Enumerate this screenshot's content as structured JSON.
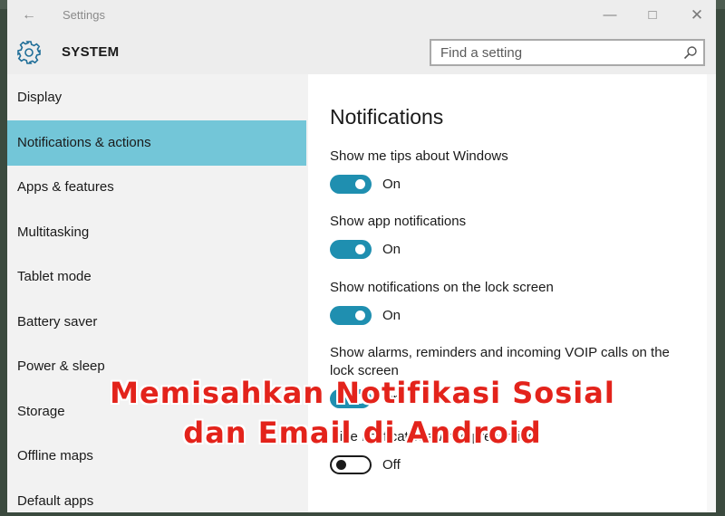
{
  "window": {
    "title": "Settings",
    "controls": [
      "minimize-icon",
      "maximize-icon",
      "close-icon"
    ]
  },
  "header": {
    "section": "SYSTEM",
    "icon": "gear-icon",
    "search_placeholder": "Find a setting"
  },
  "sidebar": {
    "items": [
      {
        "label": "Display"
      },
      {
        "label": "Notifications & actions"
      },
      {
        "label": "Apps & features"
      },
      {
        "label": "Multitasking"
      },
      {
        "label": "Tablet mode"
      },
      {
        "label": "Battery saver"
      },
      {
        "label": "Power & sleep"
      },
      {
        "label": "Storage"
      },
      {
        "label": "Offline maps"
      },
      {
        "label": "Default apps"
      }
    ],
    "active_index": 1
  },
  "main": {
    "heading": "Notifications",
    "settings": [
      {
        "label": "Show me tips about Windows",
        "state": "On"
      },
      {
        "label": "Show app notifications",
        "state": "On"
      },
      {
        "label": "Show notifications on the lock screen",
        "state": "On"
      },
      {
        "label": "Show alarms, reminders and incoming VOIP calls on the lock screen",
        "state": "On"
      },
      {
        "label": "Hide notifications while presenting",
        "state": "Off"
      }
    ]
  },
  "overlay": {
    "line1": "Memisahkan Notifikasi Sosial",
    "line2": "dan Email di Android"
  },
  "colors": {
    "accent": "#73c6d8",
    "toggle_on": "#1f8fb0",
    "overlay_text": "#e3231b"
  }
}
